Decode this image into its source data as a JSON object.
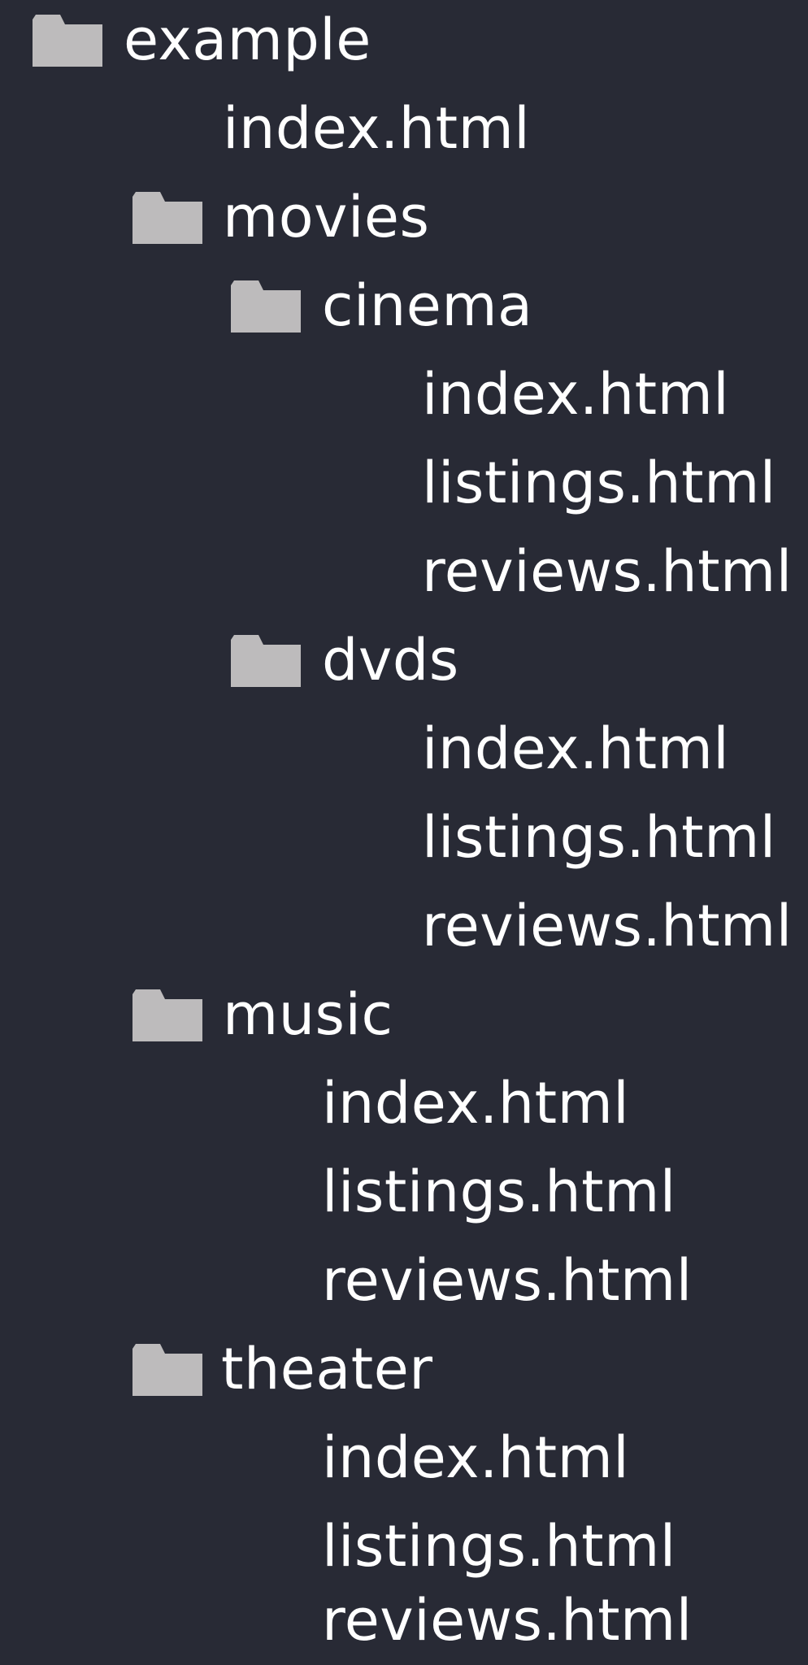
{
  "tree": {
    "root": {
      "label": "example",
      "icon": "folder-icon",
      "children": {
        "index": "index.html",
        "movies": {
          "label": "movies",
          "icon": "folder-icon",
          "cinema": {
            "label": "cinema",
            "icon": "folder-icon",
            "files": [
              "index.html",
              "listings.html",
              "reviews.html"
            ]
          },
          "dvds": {
            "label": "dvds",
            "icon": "folder-icon",
            "files": [
              "index.html",
              "listings.html",
              "reviews.html"
            ]
          }
        },
        "music": {
          "label": "music",
          "icon": "folder-icon",
          "files": [
            "index.html",
            "listings.html",
            "reviews.html"
          ]
        },
        "theater": {
          "label": "theater",
          "icon": "folder-icon",
          "files": [
            "index.html",
            "listings.html",
            "reviews.html"
          ]
        }
      }
    },
    "colors": {
      "background": "#282a35",
      "text": "#ffffff",
      "folder": "#bdbbbc"
    }
  }
}
